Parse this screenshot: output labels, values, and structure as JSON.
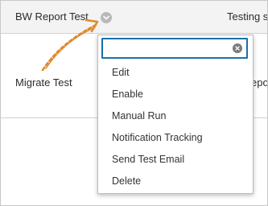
{
  "rows": [
    {
      "name": "BW Report Test",
      "status_fragment": "Testing s"
    },
    {
      "name": "Migrate Test",
      "status_fragment": "epo"
    }
  ],
  "icons": {
    "row_menu": "chevron-down-icon",
    "clear": "clear-x-icon",
    "annotation": "hand-drawn-arrow"
  },
  "menu": {
    "search_value": "",
    "items": [
      {
        "label": "Edit"
      },
      {
        "label": "Enable"
      },
      {
        "label": "Manual Run"
      },
      {
        "label": "Notification Tracking"
      },
      {
        "label": "Send Test Email"
      },
      {
        "label": "Delete"
      }
    ]
  },
  "colors": {
    "accent": "#1d6fa8",
    "annotation_arrow": "#e08a2c",
    "header_row_bg": "#f3f3f3"
  }
}
